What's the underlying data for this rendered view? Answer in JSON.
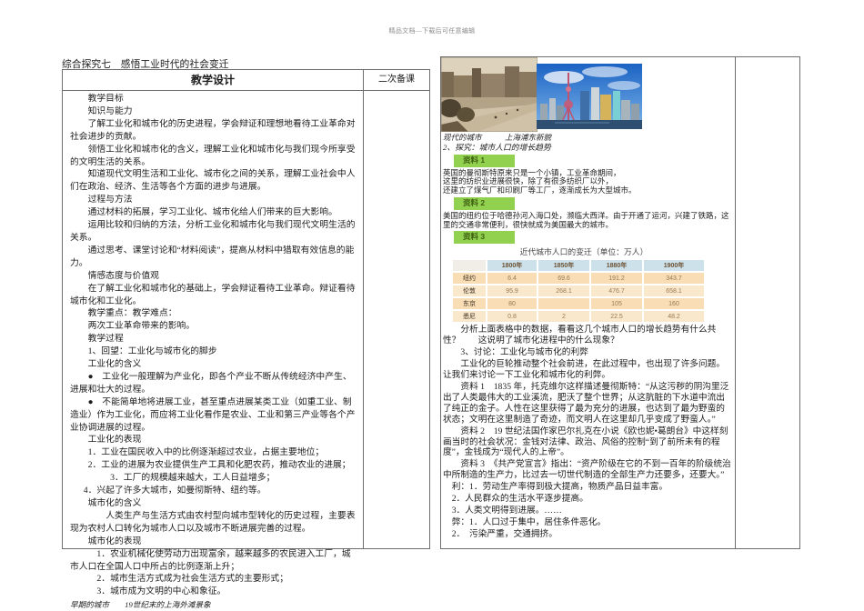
{
  "header_note": "精品文档—下载后可任意编辑",
  "lesson_title": "综合探究七　感悟工业时代的社会变迁",
  "table_headers": {
    "main": "教学设计",
    "side": "二次备课"
  },
  "colors": {
    "badge_bg": "#92d050",
    "badge_text": "#3f6212",
    "pop_table_header_bg": "#cde1ea",
    "pop_table_row_bg_a": "#f8ddb5",
    "pop_table_row_bg_b": "#fae8cd",
    "table_border": "#6e6e6e"
  },
  "left": {
    "paragraphs": [
      {
        "t": "教学目标",
        "ind": 2
      },
      {
        "t": "知识与能力",
        "ind": 2
      },
      {
        "t": "了解工业化和城市化的历史进程，学会辩证和理想地看待工业革命对社会进步的贡献。",
        "ind": 2
      },
      {
        "t": "领悟工业化和城市化的含义，理解工业化和城市化与我们现今所享受的文明生活的关系。",
        "ind": 2
      },
      {
        "t": "知道现代文明生活和工业化、城市化之间的关系，理解工业社会中人们在政治、经济、生活等各个方面的进步与进展。",
        "ind": 2
      },
      {
        "t": "过程与方法",
        "ind": 2
      },
      {
        "t": "通过材料的拓展，学习工业化、城市化给人们带来的巨大影响。",
        "ind": 2
      },
      {
        "t": "运用比较和归纳的方法，分析工业化和城市化与我们现代文明生活的关系。",
        "ind": 2
      },
      {
        "t": "通过思考、课堂讨论和“材料阅读”，提高从材料中猎取有效信息的能力。",
        "ind": 2
      },
      {
        "t": "情感态度与价值观",
        "ind": 2
      },
      {
        "t": "在了解工业化和城市化的基础上，学会辩证看待工业革命。辩证看待城市化和工业化。",
        "ind": 2
      },
      {
        "t": "教学重点：教学难点：",
        "ind": 2
      },
      {
        "t": "两次工业革命带来的影响。",
        "ind": 2
      },
      {
        "t": "教学过程",
        "ind": 2
      },
      {
        "t": "1、回望：工业化与城市化的脚步",
        "ind": 2
      },
      {
        "t": "工业化的含义",
        "ind": 2
      },
      {
        "t": "●　工业化一般理解为产业化，即各个产业不断从传统经济中产生、进展和壮大的过程。",
        "ind": 2
      },
      {
        "t": "●　不能简单地将进展工业，甚至重点进展某类工业（如重工业、制造业）作为工业化，而应将工业化看作是农业、工业和第三产业等各个产业协调进展的过程。",
        "ind": 2
      },
      {
        "t": "工业化的表现",
        "ind": 2
      },
      {
        "t": "1．工业在国民收入中的比例逐渐超过农业，占据主要地位；",
        "ind": 2
      },
      {
        "t": "2．工业的进展为农业提供生产工具和化肥农药，推动农业的进展；",
        "ind": 2
      },
      {
        "t": "3．工厂的规模越来越大，工人日益增多；",
        "ind": 4.5
      },
      {
        "t": "4．兴起了许多大城市，如曼彻斯特、纽约等。",
        "ind": 1.5
      },
      {
        "t": "城市化的含义",
        "ind": 2
      },
      {
        "t": "人类生产与生活方式由农村型向城市型转化的历史过程，主要表现为农村人口转化为城市人口以及城市不断进展完善的过程。",
        "ind": 4
      },
      {
        "t": "城市化的表现",
        "ind": 2
      },
      {
        "t": "1．农业机械化使劳动力出现富余，越来越多的农民进入工厂，城市人口在全国人口中所占的比例逐渐上升；",
        "ind": 3
      },
      {
        "t": "2．城市生活方式成为社会生活方式的主要形式；",
        "ind": 3
      },
      {
        "t": "3．城市成为文明的中心和象征。",
        "ind": 3
      }
    ],
    "caption": "早期的城市　　19世纪末的上海外滩景象"
  },
  "right": {
    "photo_caption": "现代的城市　　　上海浦东新貌",
    "blocks": [
      {
        "type": "heading",
        "t": "2、探究：城市人口的增长趋势"
      },
      {
        "type": "badge",
        "t": "资料 1"
      },
      {
        "type": "lines",
        "sz": "small",
        "lines": [
          "英国的曼彻斯特原来只是一个小镇，工业革命期间，",
          "这里的纺织业进展很快，除了有很多纺织厂以外，",
          "还建立了煤气厂和印刷厂等工厂，逐渐成长为大型城市。"
        ]
      },
      {
        "type": "badge",
        "t": "资料 2"
      },
      {
        "type": "para",
        "sz": "small",
        "ind": 0,
        "t": "美国的纽约位于哈德孙河入海口处，濒临大西洋。由于开通了运河，兴建了铁路，这里的交通非常便利，很快就成为美国最大的城市。"
      },
      {
        "type": "badge",
        "t": "资料 3"
      },
      {
        "type": "tabletitle",
        "t": "近代城市人口的变迁（单位：万人）"
      },
      {
        "type": "table"
      },
      {
        "type": "para",
        "sz": "big",
        "ind": 2,
        "t": "分析上面表格中的数据，看看这几个城市人口的增长趋势有什么共性？　　这说明了城市化进程中的什么现象？"
      },
      {
        "type": "para",
        "sz": "big",
        "ind": 2,
        "t": "3、讨论：工业化与城市化的利弊"
      },
      {
        "type": "para",
        "sz": "big",
        "ind": 2,
        "t": "工业化的巨轮推动整个社会前进，在此过程中，也出现了许多问题。让我们来讨论一下工业化和城市化的利弊。"
      },
      {
        "type": "para",
        "sz": "big",
        "ind": 2,
        "t": "资料 1　1835 年，托克维尔这样描述曼彻斯特：“从这污秽的阴沟里泛出了人类最伟大的工业溪流，肥沃了整个世界；从这肮脏的下水道中流出了纯正的金子。人性在这里获得了最为充分的进展，也达到了最为野蛮的状态；文明在这里制造了奇迹，而文明人在这里却几乎变成了野蛮人。”"
      },
      {
        "type": "para",
        "sz": "big",
        "ind": 2,
        "t": "资料 2　19 世纪法国作家巴尔扎克在小说《欧也妮•葛朗台》中这样刻画当时的社会状况：金钱对法律、政治、风俗的控制“到了前所未有的程度”，金钱成为“现代人的上帝”。"
      },
      {
        "type": "para",
        "sz": "big",
        "ind": 2,
        "t": "资料 3　《共产党宣言》指出：“资产阶级在它的不到一百年的阶级统治中所制造的生产力，比过去一切世代制造的全部生产力还要多，还要大。”"
      },
      {
        "type": "para",
        "sz": "big",
        "ind": 1,
        "t": "利：1．劳动生产率得到极大提高，物质产品日益丰富。"
      },
      {
        "type": "para",
        "sz": "big",
        "ind": 1,
        "t": "2．人民群众的生活水平逐步提高。"
      },
      {
        "type": "para",
        "sz": "big",
        "ind": 1,
        "t": "3．人类文明得到进展。……"
      },
      {
        "type": "para",
        "sz": "big",
        "ind": 1,
        "t": "弊：1．人口过于集中，居住条件恶化。"
      },
      {
        "type": "para",
        "sz": "big",
        "ind": 1,
        "t": "2．　污染严重，交通拥挤。"
      }
    ],
    "table": {
      "title": "近代城市人口的变迁（单位：万人）",
      "headers": [
        "",
        "1800年",
        "1850年",
        "1880年",
        "1900年"
      ],
      "rows": [
        [
          "纽约",
          "6.4",
          "69.6",
          "191.2",
          "343.7"
        ],
        [
          "伦敦",
          "95.9",
          "268.1",
          "476.7",
          "658.1"
        ],
        [
          "东京",
          "80",
          "",
          "105",
          "160"
        ],
        [
          "悉尼",
          "0.8",
          "2",
          "22.5",
          "48.2"
        ]
      ]
    }
  }
}
